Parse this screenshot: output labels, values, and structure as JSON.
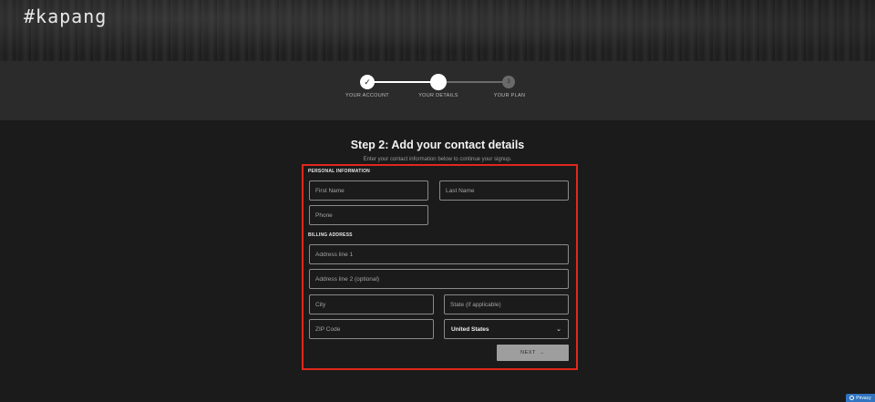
{
  "header": {
    "logo": "#kapang"
  },
  "stepper": {
    "steps": [
      {
        "label": "YOUR ACCOUNT",
        "state": "complete"
      },
      {
        "label": "YOUR DETAILS",
        "state": "current"
      },
      {
        "label": "YOUR PLAN",
        "state": "upcoming",
        "number": "3"
      }
    ]
  },
  "page": {
    "title": "Step 2: Add your contact details",
    "subtitle": "Enter your contact information below to continue your signup."
  },
  "form": {
    "personal_label": "PERSONAL INFORMATION",
    "first_name_placeholder": "First Name",
    "last_name_placeholder": "Last Name",
    "phone_placeholder": "Phone",
    "billing_label": "BILLING ADDRESS",
    "address1_placeholder": "Address line 1",
    "address2_placeholder": "Address line 2 (optional)",
    "city_placeholder": "City",
    "state_placeholder": "State (if applicable)",
    "zip_placeholder": "ZIP Code",
    "country_selected": "United States",
    "next_label": "NEXT",
    "next_arrow": "→"
  },
  "privacy_badge": {
    "label": "Privacy"
  },
  "colors": {
    "highlight_border": "#e0281c",
    "background": "#1b1b1b",
    "stepper_band": "#2b2b2b",
    "privacy_blue": "#2f74c0"
  }
}
